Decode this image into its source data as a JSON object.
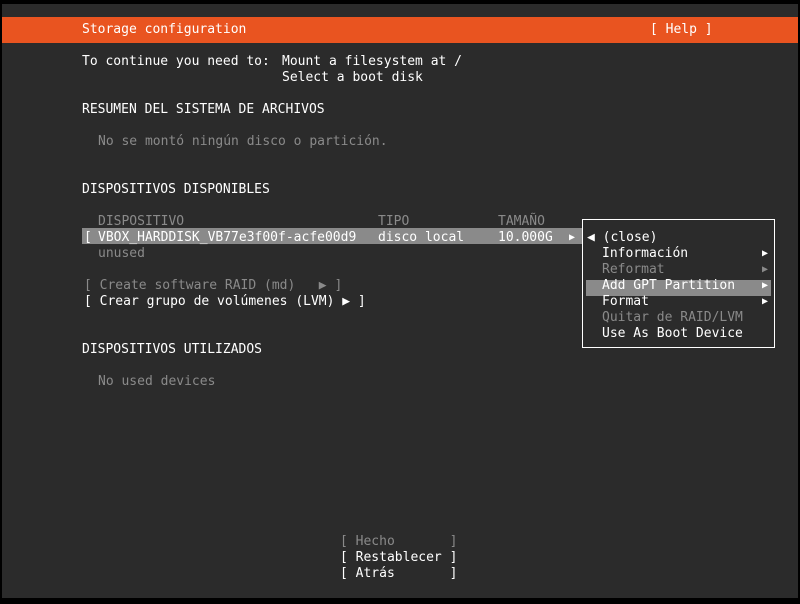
{
  "header": {
    "title": "Storage configuration",
    "help": "[ Help ]"
  },
  "instructions": {
    "lead": "To continue you need to:",
    "items": [
      "Mount a filesystem at /",
      "Select a boot disk"
    ]
  },
  "filesystem_summary": {
    "heading": "RESUMEN DEL SISTEMA DE ARCHIVOS",
    "empty": "No se montó ningún disco o partición."
  },
  "available_devices": {
    "heading": "DISPOSITIVOS DISPONIBLES",
    "columns": [
      "DISPOSITIVO",
      "TIPO",
      "TAMAÑO"
    ],
    "rows": [
      {
        "bracket": "[",
        "device": "VBOX_HARDDISK_VB77e3f00f-acfe00d9",
        "type": "disco local",
        "size": "10.000G",
        "arrow": "▶",
        "sub": "unused"
      }
    ],
    "actions": [
      {
        "label": "[ Create software RAID (md)   ▶ ]",
        "enabled": false
      },
      {
        "label": "[ Crear grupo de volúmenes (LVM) ▶ ]",
        "enabled": true
      }
    ]
  },
  "used_devices": {
    "heading": "DISPOSITIVOS UTILIZADOS",
    "empty": "No used devices"
  },
  "context_menu": {
    "close": "◀ (close)",
    "items": [
      {
        "label": "Información",
        "arrow": "▶",
        "enabled": true
      },
      {
        "label": "Reformat",
        "arrow": "▶",
        "enabled": false
      },
      {
        "label": "Add GPT Partition",
        "arrow": "▶",
        "enabled": true,
        "selected": true
      },
      {
        "label": "Format",
        "arrow": "▶",
        "enabled": true
      },
      {
        "label": "Quitar de RAID/LVM",
        "arrow": "",
        "enabled": false
      },
      {
        "label": "Use As Boot Device",
        "arrow": "",
        "enabled": true
      }
    ]
  },
  "footer": {
    "buttons": [
      {
        "label": "[ Hecho       ]",
        "enabled": false
      },
      {
        "label": "[ Restablecer ]",
        "enabled": true
      },
      {
        "label": "[ Atrás       ]",
        "enabled": true
      }
    ]
  },
  "colors": {
    "accent": "#e95420",
    "background": "#2b2b2b",
    "selection": "#8a8a8a",
    "disabled_text": "#8a8a8a"
  }
}
